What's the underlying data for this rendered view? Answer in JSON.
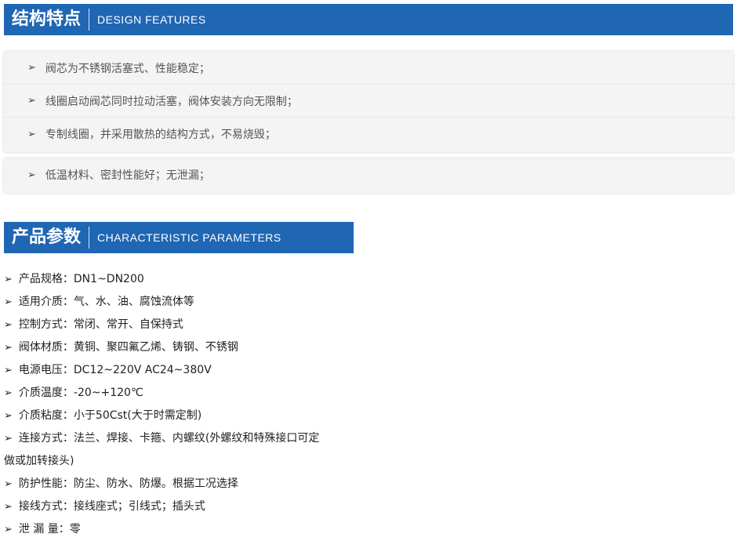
{
  "design_features": {
    "title_zh": "结构特点",
    "title_en": "DESIGN FEATURES",
    "arrow": "➢",
    "group1": [
      "阀芯为不锈钢活塞式、性能稳定；",
      "线圈启动阀芯同时拉动活塞，阀体安装方向无限制；",
      "专制线圈，并采用散热的结构方式，不易烧毁；"
    ],
    "group2": [
      "低温材料、密封性能好；无泄漏；"
    ]
  },
  "parameters": {
    "title_zh": "产品参数",
    "title_en": "CHARACTERISTIC PARAMETERS",
    "arrow": "➢",
    "items": [
      "产品规格：DN1~DN200",
      "适用介质：气、水、油、腐蚀流体等",
      "控制方式：常闭、常开、自保持式",
      "阀体材质：黄铜、聚四氟乙烯、铸钢、不锈钢",
      "电源电压：DC12~220V  AC24~380V",
      "介质温度：-20~+120℃",
      "介质粘度：小于50Cst(大于时需定制)",
      "连接方式：法兰、焊接、卡箍、内螺纹(外螺纹和特殊接口可定",
      "做或加转接头)",
      "防护性能：防尘、防水、防爆。根据工况选择",
      "接线方式：接线座式；引线式；插头式",
      "泄 漏 量：零"
    ]
  },
  "colors": {
    "header_bg": "#1f66b3",
    "box_bg": "#f4f4f4"
  }
}
